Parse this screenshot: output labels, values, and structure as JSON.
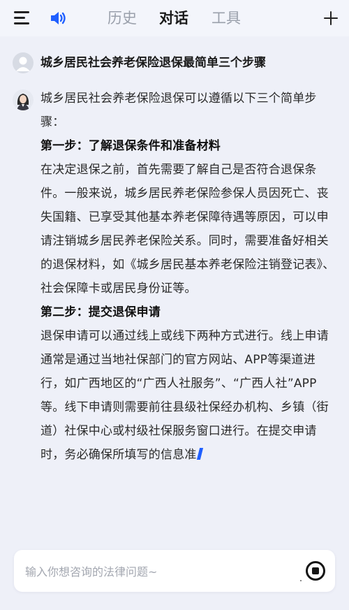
{
  "header": {
    "menu_icon": "hamburger-menu-icon",
    "speaker_icon": "speaker-icon",
    "tabs": [
      {
        "label": "历史",
        "active": false
      },
      {
        "label": "对话",
        "active": true
      },
      {
        "label": "工具",
        "active": false
      }
    ],
    "new_icon": "plus-icon"
  },
  "chat": {
    "question": "城乡居民社会养老保险退保最简单三个步骤",
    "answer": {
      "intro": "城乡居民社会养老保险退保可以遵循以下三个简单步骤：",
      "step1_title": "第一步：了解退保条件和准备材料",
      "step1_body": "在决定退保之前，首先需要了解自己是否符合退保条件。一般来说，城乡居民养老保险参保人员因死亡、丧失国籍、已享受其他基本养老保障待遇等原因，可以申请注销城乡居民养老保险关系。同时，需要准备好相关的退保材料，如《城乡居民基本养老保险注销登记表》、社会保障卡或居民身份证等。",
      "step2_title": "第二步：提交退保申请",
      "step2_body": "退保申请可以通过线上或线下两种方式进行。线上申请通常是通过当地社保部门的官方网站、APP等渠道进行，如广西地区的“广西人社服务”、“广西人社”APP等。线下申请则需要前往县级社保经办机构、乡镇（街道）社保中心或村级社保服务窗口进行。在提交申请时，务必确保所填写的信息准"
    }
  },
  "input": {
    "placeholder": "输入你想咨询的法律问题~",
    "value": "",
    "stop_icon": "stop-icon"
  },
  "colors": {
    "background": "#eef0f8",
    "accent": "#1f5fff",
    "tab_inactive": "#9aa0ab"
  }
}
